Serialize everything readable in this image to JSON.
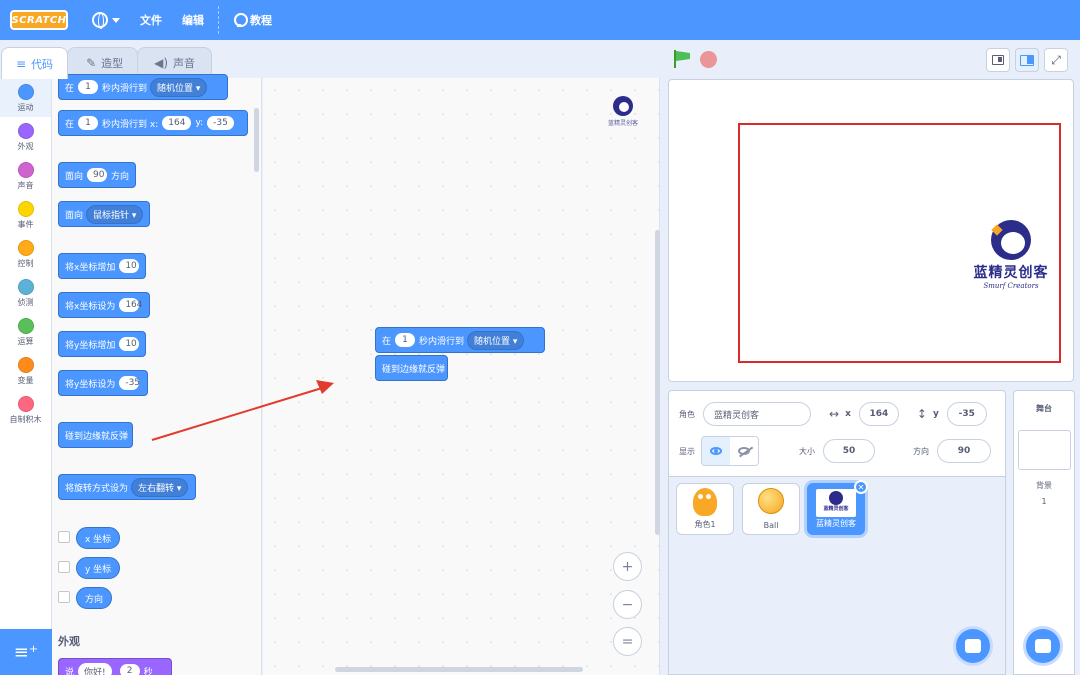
{
  "menubar": {
    "logo": "SCRATCH",
    "file": "文件",
    "edit": "编辑",
    "tutorials": "教程"
  },
  "tabs": [
    {
      "label": "代码",
      "icon": "code-icon"
    },
    {
      "label": "造型",
      "icon": "brush-icon"
    },
    {
      "label": "声音",
      "icon": "speaker-icon"
    }
  ],
  "categories": [
    {
      "label": "运动",
      "color": "#4c97ff"
    },
    {
      "label": "外观",
      "color": "#9966ff"
    },
    {
      "label": "声音",
      "color": "#cf63cf"
    },
    {
      "label": "事件",
      "color": "#ffd500"
    },
    {
      "label": "控制",
      "color": "#ffab19"
    },
    {
      "label": "侦测",
      "color": "#5cb1d6"
    },
    {
      "label": "运算",
      "color": "#59c059"
    },
    {
      "label": "变量",
      "color": "#ff8c1a"
    },
    {
      "label": "自制积木",
      "color": "#ff6680"
    }
  ],
  "palette": {
    "glide_random": {
      "pre": "在",
      "num": "1",
      "mid": "秒内滑行到",
      "drop": "随机位置"
    },
    "glide_xy": {
      "pre": "在",
      "num": "1",
      "mid": "秒内滑行到 x:",
      "x": "164",
      "ylabel": "y:",
      "y": "-35"
    },
    "point_dir": {
      "pre": "面向",
      "num": "90",
      "post": "方向"
    },
    "point_towards": {
      "pre": "面向",
      "drop": "鼠标指针"
    },
    "change_x": {
      "pre": "将x坐标增加",
      "num": "10"
    },
    "set_x": {
      "pre": "将x坐标设为",
      "num": "164"
    },
    "change_y": {
      "pre": "将y坐标增加",
      "num": "10"
    },
    "set_y": {
      "pre": "将y坐标设为",
      "num": "-35"
    },
    "bounce": "碰到边缘就反弹",
    "rotation": {
      "pre": "将旋转方式设为",
      "drop": "左右翻转"
    },
    "rep_x": "x 坐标",
    "rep_y": "y 坐标",
    "rep_dir": "方向",
    "looks_heading": "外观",
    "looks_block": {
      "pre": "说",
      "num1": "你好!",
      "num2": "2",
      "post": "秒"
    }
  },
  "script": {
    "glide": {
      "pre": "在",
      "num": "1",
      "mid": "秒内滑行到",
      "drop": "随机位置"
    },
    "bounce": "碰到边缘就反弹"
  },
  "zoom": {
    "in": "+",
    "out": "−",
    "reset": "="
  },
  "watermark": {
    "title": "蓝精灵创客",
    "sub": "Smurf Creators"
  },
  "stage_logo": {
    "title": "蓝精灵创客",
    "sub": "Smurf Creators"
  },
  "sprite_info": {
    "sprite_label": "角色",
    "sprite_name": "蓝精灵创客",
    "x_label": "x",
    "x": "164",
    "y_label": "y",
    "y": "-35",
    "show_label": "显示",
    "size_label": "大小",
    "size": "50",
    "direction_label": "方向",
    "direction": "90"
  },
  "sprites": [
    {
      "name": "角色1"
    },
    {
      "name": "Ball"
    },
    {
      "name": "蓝精灵创客",
      "thumb_text": "蓝精灵创客"
    }
  ],
  "stage_pane": {
    "title": "舞台",
    "backdrop_label": "背景",
    "backdrop_count": "1"
  },
  "colors": {
    "motion": "#4c97ff",
    "accent": "#4c97ff",
    "highlight": "#d92b2b"
  }
}
